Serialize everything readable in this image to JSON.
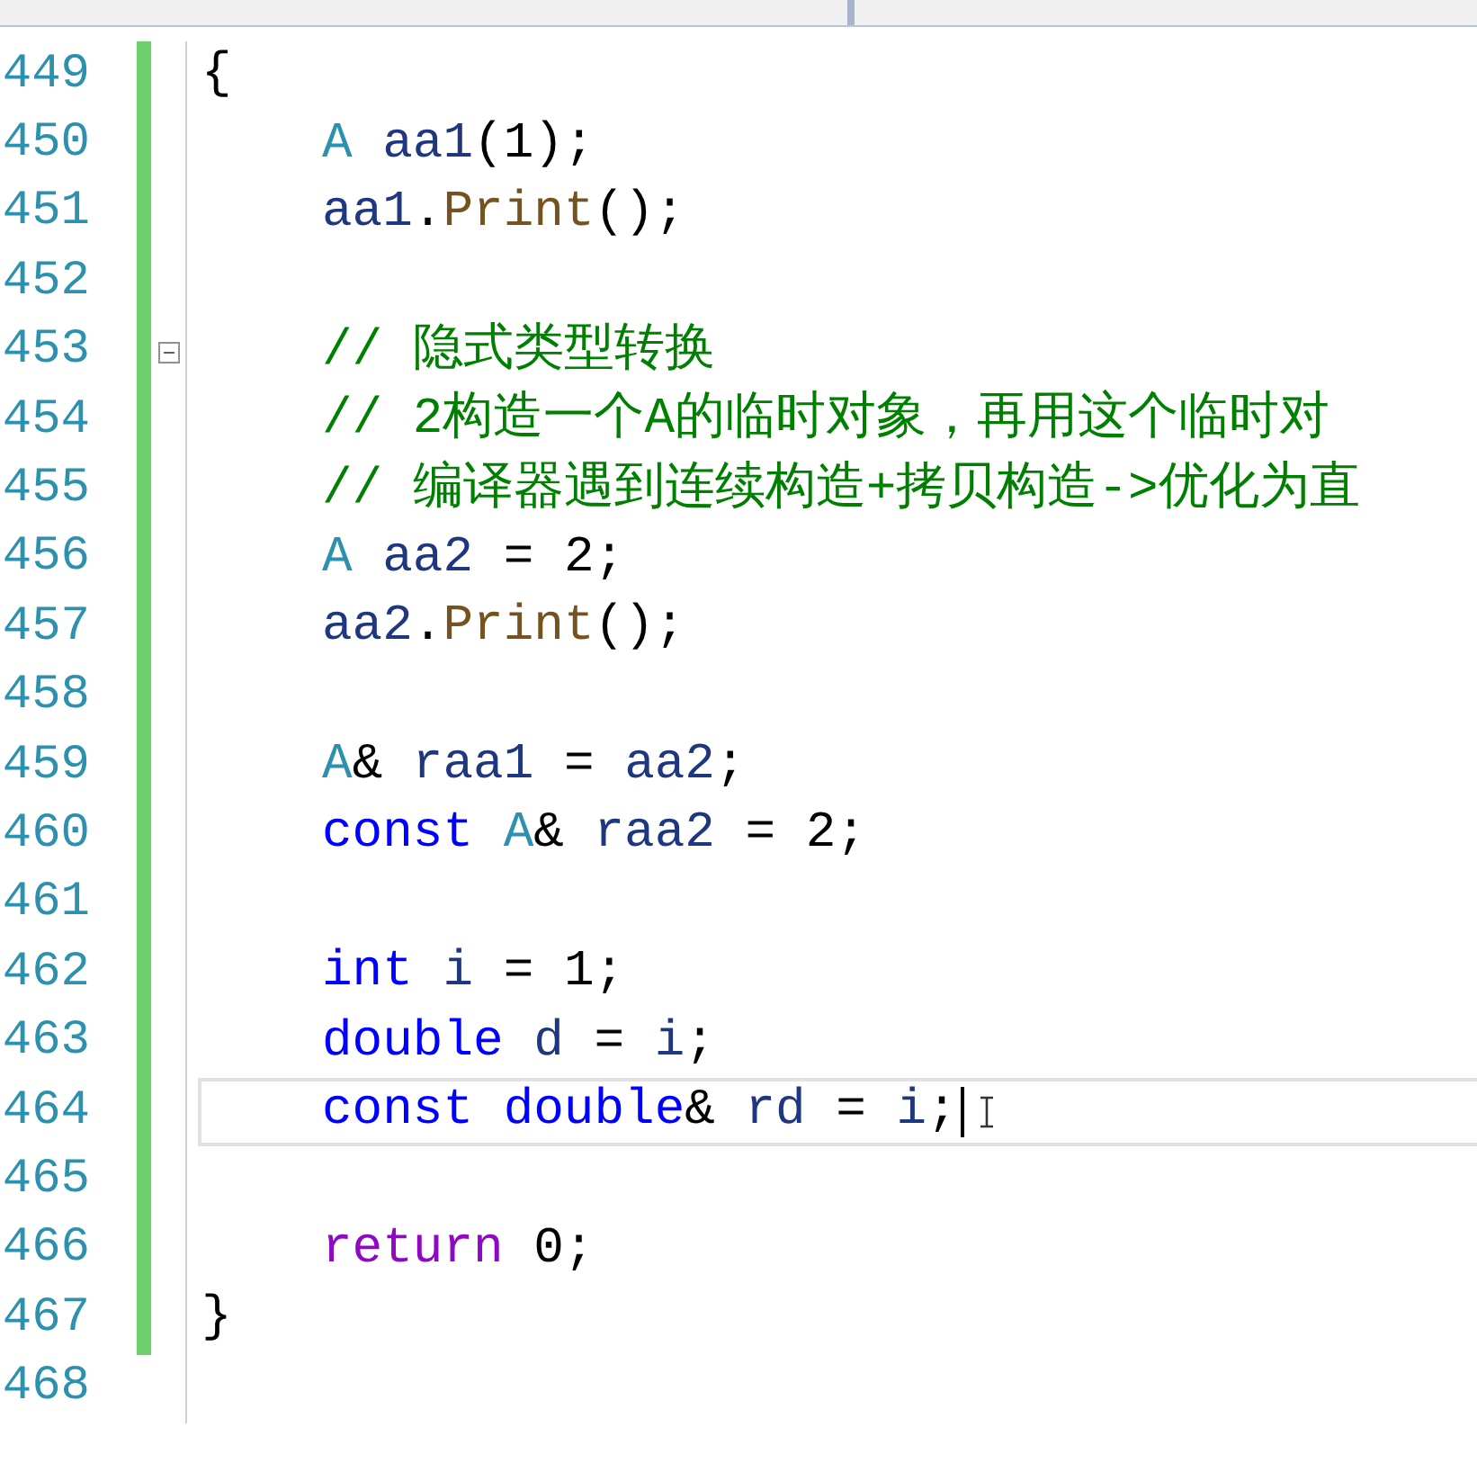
{
  "editor": {
    "lines": [
      {
        "number": "449",
        "current": false,
        "fold_start": false,
        "tokens": [
          {
            "kind": "plain",
            "text": "{"
          }
        ],
        "children": [
          {
            "number": "450",
            "current": false,
            "fold_start": false,
            "tokens": [
              {
                "kind": "type",
                "text": "A"
              },
              {
                "kind": "variable",
                "text": " aa1"
              },
              {
                "kind": "plain",
                "text": "(1);"
              }
            ]
          },
          {
            "number": "451",
            "current": false,
            "fold_start": false,
            "tokens": [
              {
                "kind": "variable",
                "text": "aa1"
              },
              {
                "kind": "plain",
                "text": "."
              },
              {
                "kind": "function",
                "text": "Print"
              },
              {
                "kind": "plain",
                "text": "();"
              }
            ]
          },
          {
            "number": "452",
            "current": false,
            "fold_start": false
          },
          {
            "number": "453",
            "current": false,
            "fold_start": true,
            "tokens": [
              {
                "kind": "comment",
                "text": "// 隐式类型转换"
              }
            ]
          },
          {
            "number": "454",
            "current": false,
            "fold_start": false,
            "tokens": [
              {
                "kind": "comment",
                "text": "// 2构造一个A的临时对象，再用这个临时对"
              }
            ]
          },
          {
            "number": "455",
            "current": false,
            "fold_start": false,
            "tokens": [
              {
                "kind": "comment",
                "text": "// 编译器遇到连续构造+拷贝构造->优化为直"
              }
            ]
          },
          {
            "number": "456",
            "current": false,
            "fold_start": false,
            "tokens": [
              {
                "kind": "type",
                "text": "A"
              },
              {
                "kind": "variable",
                "text": " aa2"
              },
              {
                "kind": "plain",
                "text": " = 2;"
              }
            ]
          },
          {
            "number": "457",
            "current": false,
            "fold_start": false,
            "tokens": [
              {
                "kind": "variable",
                "text": "aa2"
              },
              {
                "kind": "plain",
                "text": "."
              },
              {
                "kind": "function",
                "text": "Print"
              },
              {
                "kind": "plain",
                "text": "();"
              }
            ]
          },
          {
            "number": "458",
            "current": false,
            "fold_start": false
          },
          {
            "number": "459",
            "current": false,
            "fold_start": false,
            "tokens": [
              {
                "kind": "type",
                "text": "A"
              },
              {
                "kind": "plain",
                "text": "& "
              },
              {
                "kind": "variable",
                "text": "raa1"
              },
              {
                "kind": "plain",
                "text": " = "
              },
              {
                "kind": "variable",
                "text": "aa2"
              },
              {
                "kind": "plain",
                "text": ";"
              }
            ]
          },
          {
            "number": "460",
            "current": false,
            "fold_start": false,
            "tokens": [
              {
                "kind": "keyword",
                "text": "const"
              },
              {
                "kind": "type",
                "text": " A"
              },
              {
                "kind": "plain",
                "text": "& "
              },
              {
                "kind": "variable",
                "text": "raa2"
              },
              {
                "kind": "plain",
                "text": " = 2;"
              }
            ]
          },
          {
            "number": "461",
            "current": false,
            "fold_start": false
          },
          {
            "number": "462",
            "current": false,
            "fold_start": false,
            "tokens": [
              {
                "kind": "keyword",
                "text": "int"
              },
              {
                "kind": "variable",
                "text": " i"
              },
              {
                "kind": "plain",
                "text": " = 1;"
              }
            ]
          },
          {
            "number": "463",
            "current": false,
            "fold_start": false,
            "tokens": [
              {
                "kind": "keyword",
                "text": "double"
              },
              {
                "kind": "variable",
                "text": " d"
              },
              {
                "kind": "plain",
                "text": " = "
              },
              {
                "kind": "variable",
                "text": "i"
              },
              {
                "kind": "plain",
                "text": ";"
              }
            ]
          },
          {
            "number": "464",
            "current": true,
            "fold_start": false,
            "tokens": [
              {
                "kind": "keyword",
                "text": "const"
              },
              {
                "kind": "keyword",
                "text": " double"
              },
              {
                "kind": "plain",
                "text": "& "
              },
              {
                "kind": "variable",
                "text": "rd"
              },
              {
                "kind": "plain",
                "text": " = "
              },
              {
                "kind": "variable",
                "text": "i"
              },
              {
                "kind": "plain",
                "text": ";"
              }
            ]
          },
          {
            "number": "465",
            "current": false,
            "fold_start": false
          },
          {
            "number": "466",
            "current": false,
            "fold_start": false,
            "tokens": [
              {
                "kind": "control",
                "text": "return"
              },
              {
                "kind": "plain",
                "text": " 0;"
              }
            ]
          }
        ]
      },
      {
        "number": "467",
        "current": false,
        "fold_start": false,
        "tokens": [
          {
            "kind": "plain",
            "text": "}"
          }
        ]
      },
      {
        "number": "468",
        "current": false,
        "fold_start": false
      }
    ]
  }
}
